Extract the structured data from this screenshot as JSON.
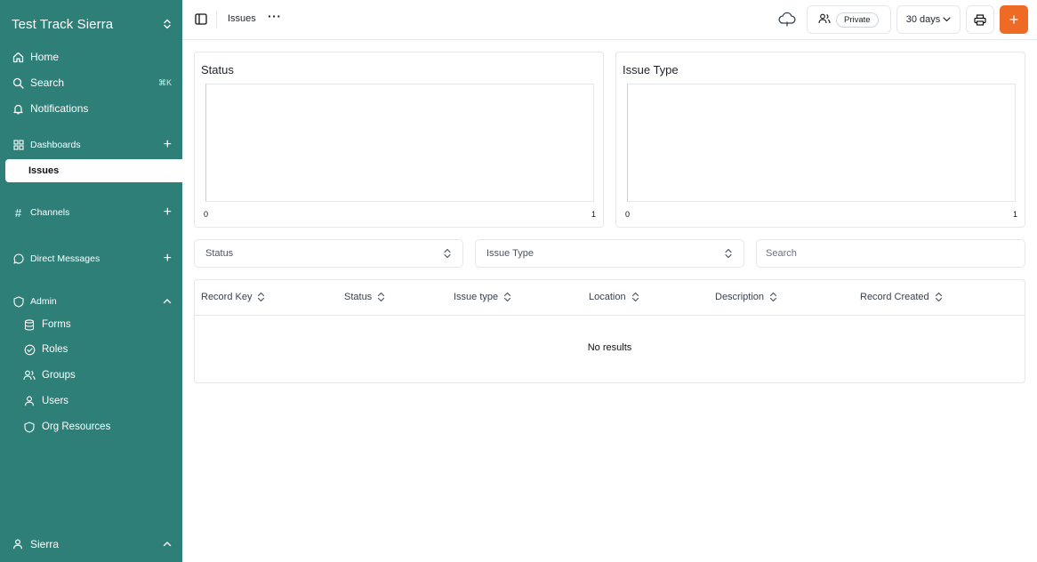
{
  "sidebar": {
    "workspace": "Test Track Sierra",
    "home": "Home",
    "search": "Search",
    "search_shortcut": "⌘K",
    "notifications": "Notifications",
    "dashboards": "Dashboards",
    "issues": "Issues",
    "channels": "Channels",
    "direct_messages": "Direct Messages",
    "admin": "Admin",
    "admin_items": [
      "Forms",
      "Roles",
      "Groups",
      "Users",
      "Org Resources"
    ],
    "user": "Sierra"
  },
  "header": {
    "breadcrumb": "Issues",
    "more": "···",
    "visibility": "Private",
    "range": "30 days",
    "add": "+"
  },
  "charts": [
    {
      "title": "Status",
      "xmin": "0",
      "xmax": "1"
    },
    {
      "title": "Issue Type",
      "xmin": "0",
      "xmax": "1"
    }
  ],
  "filters": {
    "status": "Status",
    "issue_type": "Issue Type",
    "search_placeholder": "Search"
  },
  "table": {
    "columns": [
      "Record Key",
      "Status",
      "Issue type",
      "Location",
      "Description",
      "Record Created"
    ],
    "empty": "No results"
  },
  "colors": {
    "sidebar": "#2e7f78",
    "accent": "#ef6a25"
  }
}
